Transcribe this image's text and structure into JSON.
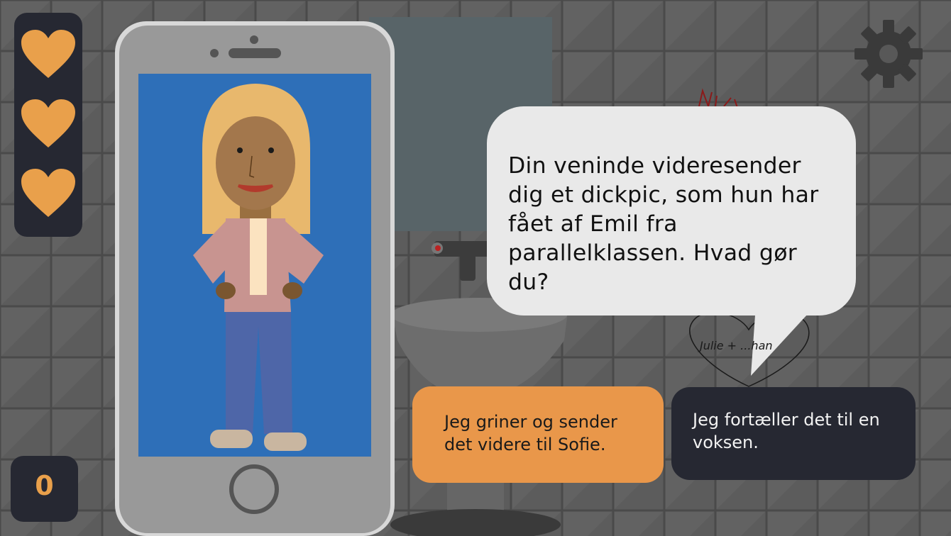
{
  "hud": {
    "lives": 3,
    "icons": [
      "heart-icon",
      "heart-icon",
      "heart-icon"
    ],
    "score": "0",
    "settings_icon": "gear-icon"
  },
  "speech": {
    "text": "Din veninde videresender dig et dickpic, som hun har fået af Emil fra parallelklassen. Hvad gør du?"
  },
  "choices": [
    {
      "label": "Jeg griner og sender det videre til Sofie."
    },
    {
      "label": "Jeg fortæller det til en voksen."
    }
  ],
  "scene": {
    "graffiti": "Julie + ...han"
  },
  "colors": {
    "accent": "#E9974A",
    "panel": "#262832",
    "phone_screen": "#2E6FB8",
    "wall": "#585858"
  }
}
